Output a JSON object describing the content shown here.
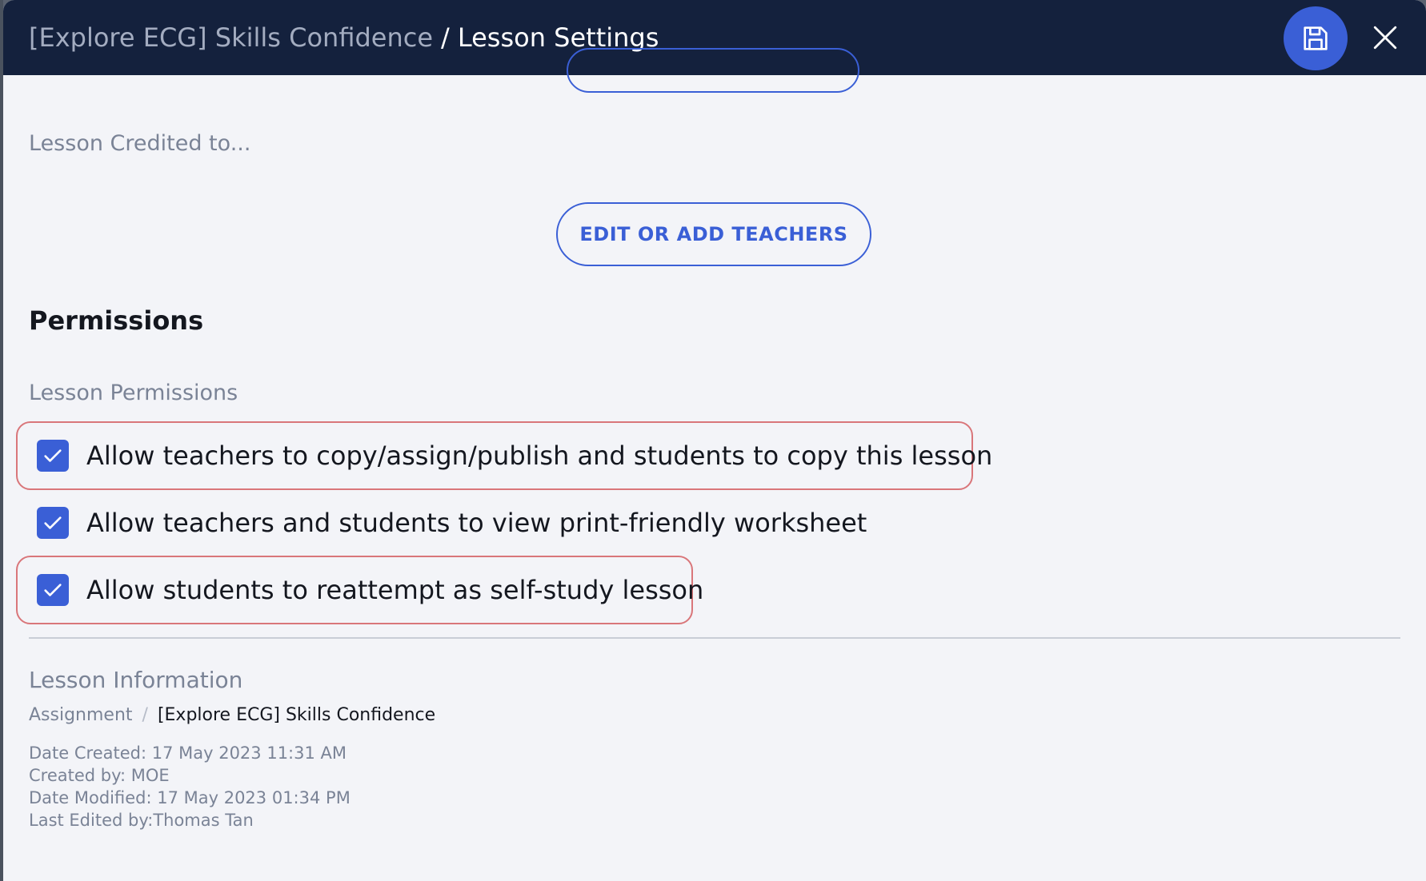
{
  "header": {
    "course_title": "[Explore ECG] Skills Confidence",
    "separator": "/",
    "page_title": "Lesson Settings",
    "save_icon": "floppy-disk-icon",
    "close_icon": "close-x-icon"
  },
  "credits": {
    "label": "Lesson Credited to...",
    "edit_button_label": "EDIT OR ADD TEACHERS"
  },
  "permissions": {
    "heading": "Permissions",
    "subheading": "Lesson Permissions",
    "items": [
      {
        "label": "Allow teachers to copy/assign/publish and students to copy this lesson",
        "checked": true,
        "highlighted": true
      },
      {
        "label": "Allow teachers and students to view print-friendly worksheet",
        "checked": true,
        "highlighted": false
      },
      {
        "label": "Allow students to reattempt as self-study lesson",
        "checked": true,
        "highlighted": true
      }
    ]
  },
  "lesson_info": {
    "heading": "Lesson Information",
    "type": "Assignment",
    "slash": "/",
    "name": "[Explore ECG] Skills Confidence",
    "date_created": "Date Created: 17 May 2023 11:31 AM",
    "created_by": "Created by: MOE",
    "date_modified": "Date Modified: 17 May 2023 01:34 PM",
    "last_edited_by": "Last Edited by:Thomas Tan"
  },
  "colors": {
    "header_bg": "#14213d",
    "accent": "#3a5fd6",
    "highlight_border": "#d9767a",
    "page_bg": "#f3f4f8"
  }
}
